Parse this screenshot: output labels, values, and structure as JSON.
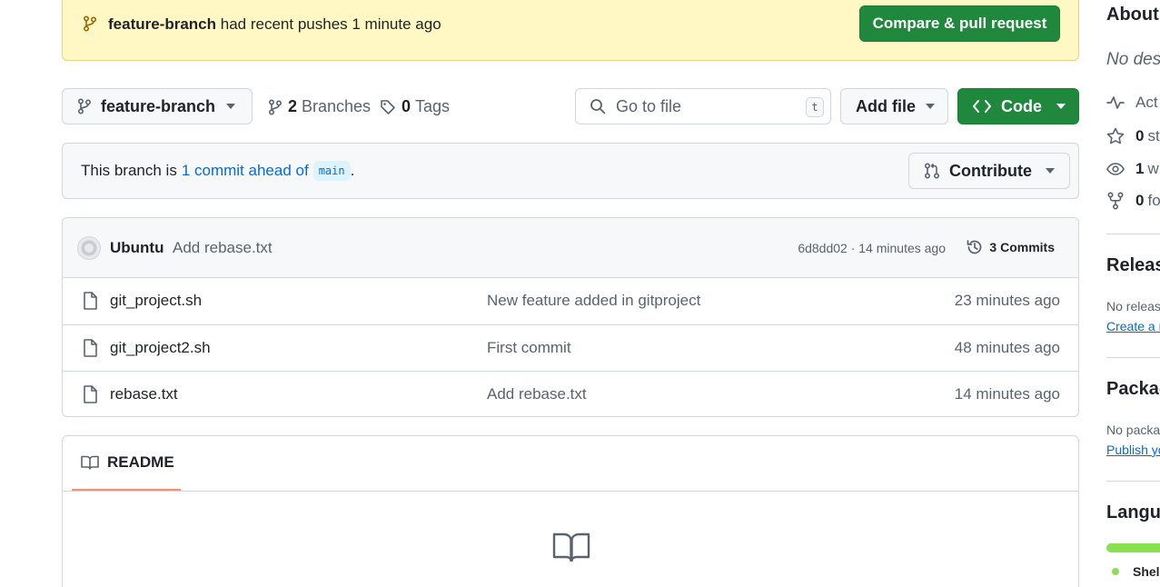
{
  "banner": {
    "branch": "feature-branch",
    "message": "had recent pushes 1 minute ago",
    "button": "Compare & pull request"
  },
  "toolbar": {
    "branch_select": "feature-branch",
    "branches_count": "2",
    "branches_label": "Branches",
    "tags_count": "0",
    "tags_label": "Tags",
    "search_placeholder": "Go to file",
    "search_shortcut": "t",
    "add_file": "Add file",
    "code": "Code"
  },
  "ahead": {
    "prefix": "This branch is",
    "link": "1 commit ahead of",
    "base": "main",
    "suffix": ".",
    "contribute": "Contribute"
  },
  "latest_commit": {
    "author": "Ubuntu",
    "message": "Add rebase.txt",
    "sha_time": "6d8dd02 · 14 minutes ago",
    "commits_label": "3 Commits"
  },
  "files": [
    {
      "name": "git_project.sh",
      "message": "New feature added in gitproject",
      "time": "23 minutes ago"
    },
    {
      "name": "git_project2.sh",
      "message": "First commit",
      "time": "48 minutes ago"
    },
    {
      "name": "rebase.txt",
      "message": "Add rebase.txt",
      "time": "14 minutes ago"
    }
  ],
  "readme": {
    "tab": "README"
  },
  "sidebar": {
    "about": "About",
    "description": "No des",
    "activity": "Act",
    "stars_count": "0",
    "stars": "st",
    "watching_count": "1",
    "watching": "w",
    "forks_count": "0",
    "forks": "fo",
    "releases": "Release",
    "releases_empty": "No releas",
    "releases_link": "Create a r",
    "packages": "Packag",
    "packages_empty": "No packa",
    "packages_link": "Publish yo",
    "languages": "Langua",
    "language_name": "Shell"
  },
  "colors": {
    "primary_green": "#1f883d",
    "banner_bg": "#fff8c5",
    "link_blue": "#0969da",
    "shell_language": "#89e051",
    "tab_underline": "#fd8c73"
  }
}
